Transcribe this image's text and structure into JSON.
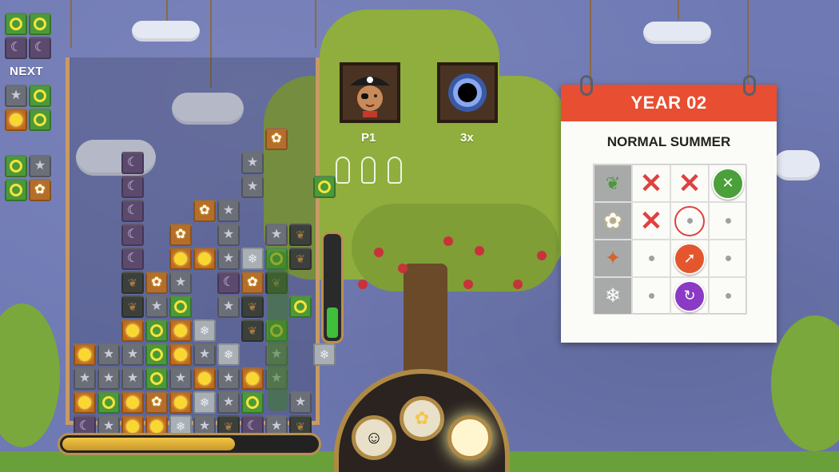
{
  "next_panel": {
    "label": "NEXT"
  },
  "players": {
    "p1": {
      "label": "P1",
      "avatar": "pirate-avatar"
    },
    "p2": {
      "label": "3x",
      "avatar": "black-hole-avatar"
    }
  },
  "calendar": {
    "title": "YEAR 02",
    "subtitle": "NORMAL SUMMER",
    "rows": [
      {
        "season": "spring-leaf-icon",
        "cells": [
          "cross",
          "cross",
          "crossed-badge"
        ]
      },
      {
        "season": "summer-flower-icon",
        "cells": [
          "cross",
          "current",
          "dot"
        ]
      },
      {
        "season": "autumn-leaf-icon",
        "cells": [
          "dot",
          "rocket-badge",
          "dot"
        ]
      },
      {
        "season": "winter-snowflake-icon",
        "cells": [
          "dot",
          "swirl-badge",
          "dot"
        ]
      }
    ]
  },
  "progress": {
    "bottom_bar_fraction": 0.68,
    "side_gauge_fraction": 0.3
  },
  "colors": {
    "calendar_header": "#e84e31",
    "tree": "#8fae3d",
    "background": "#6f79b4"
  }
}
